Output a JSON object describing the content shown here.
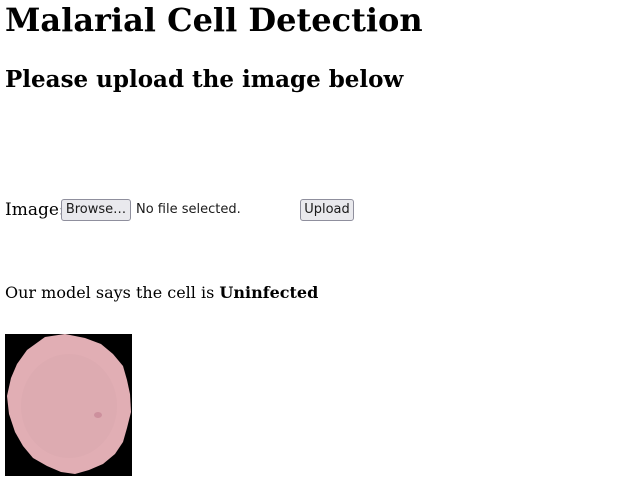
{
  "page": {
    "title": "Malarial Cell Detection",
    "subtitle": "Please upload the image below"
  },
  "form": {
    "image_label": "Image:",
    "browse_label": "Browse…",
    "file_status": "No file selected.",
    "upload_label": "Upload"
  },
  "result": {
    "prefix": "Our model says the cell is ",
    "prediction": "Uninfected"
  },
  "colors": {
    "cell": "#e1aeb4",
    "cell_spot": "#c98a98",
    "background": "#000000"
  }
}
